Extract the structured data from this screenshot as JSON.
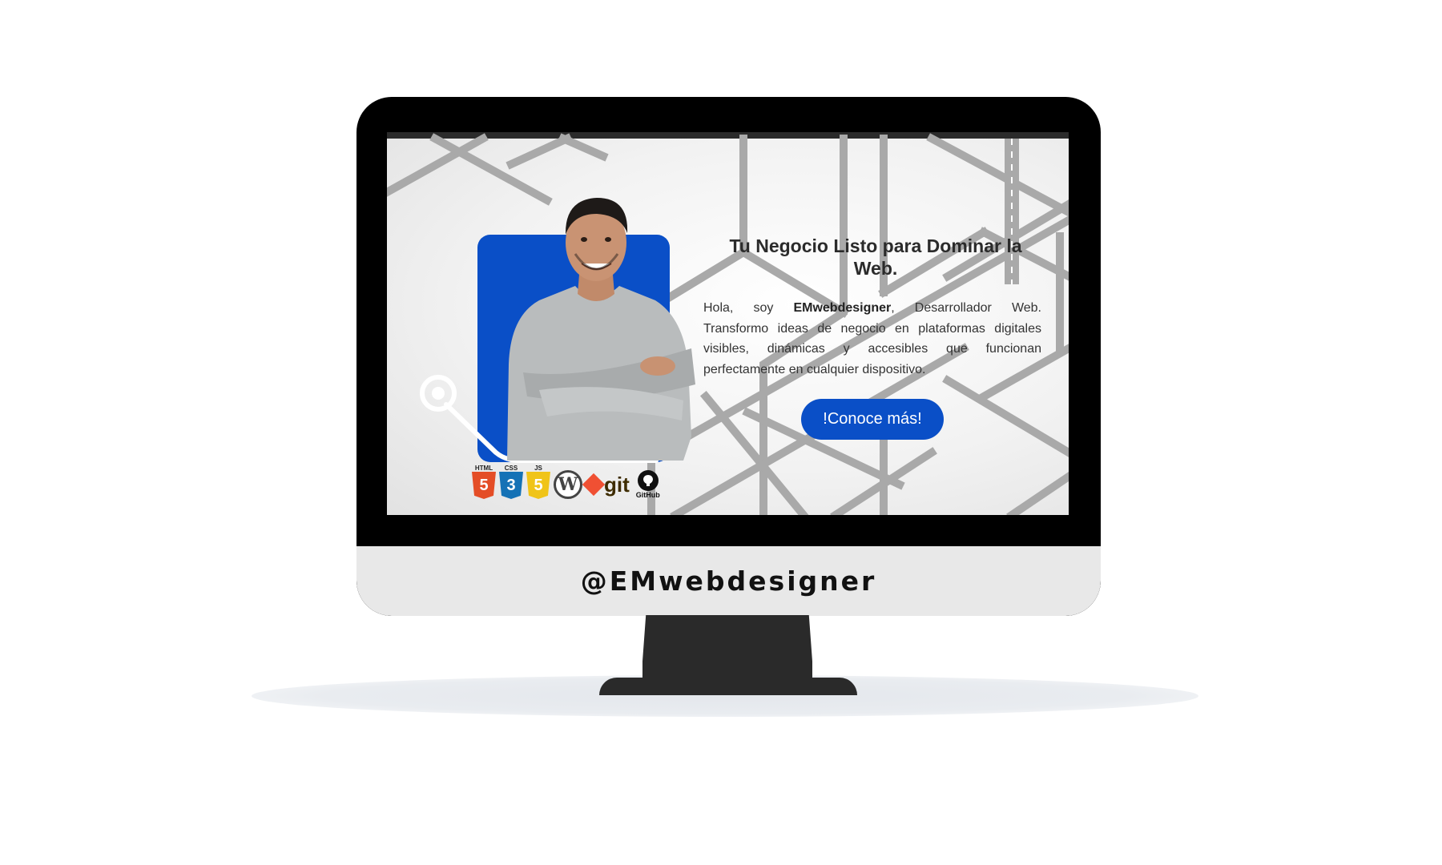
{
  "hero": {
    "title": "Tu Negocio Listo para Dominar la Web.",
    "text_intro": "Hola, soy ",
    "text_brand": "EMwebdesigner",
    "text_rest": ", Desarrollador Web. Transformo ideas de negocio en plataformas digitales visibles, dinámicas y accesibles que funcionan perfectamente en cualquier dispositivo.",
    "cta_label": "!Conoce más!"
  },
  "tech_logos": [
    {
      "label": "HTML",
      "glyph": "5",
      "color": "#e44d26",
      "icon": "html5-icon"
    },
    {
      "label": "CSS",
      "glyph": "3",
      "color": "#1572b6",
      "icon": "css3-icon"
    },
    {
      "label": "JS",
      "glyph": "5",
      "color": "#f0c419",
      "icon": "javascript-icon"
    },
    {
      "label": "",
      "glyph": "W",
      "color": "#444444",
      "icon": "wordpress-icon"
    },
    {
      "label": "git",
      "glyph": "",
      "color": "#f05033",
      "icon": "git-icon"
    },
    {
      "label": "GitHub",
      "glyph": "",
      "color": "#111111",
      "icon": "github-icon"
    }
  ],
  "monitor": {
    "chin_label": "@EMwebdesigner"
  },
  "colors": {
    "accent": "#0a4fc7",
    "frame": "#000000",
    "chin": "#e8e8e8"
  }
}
